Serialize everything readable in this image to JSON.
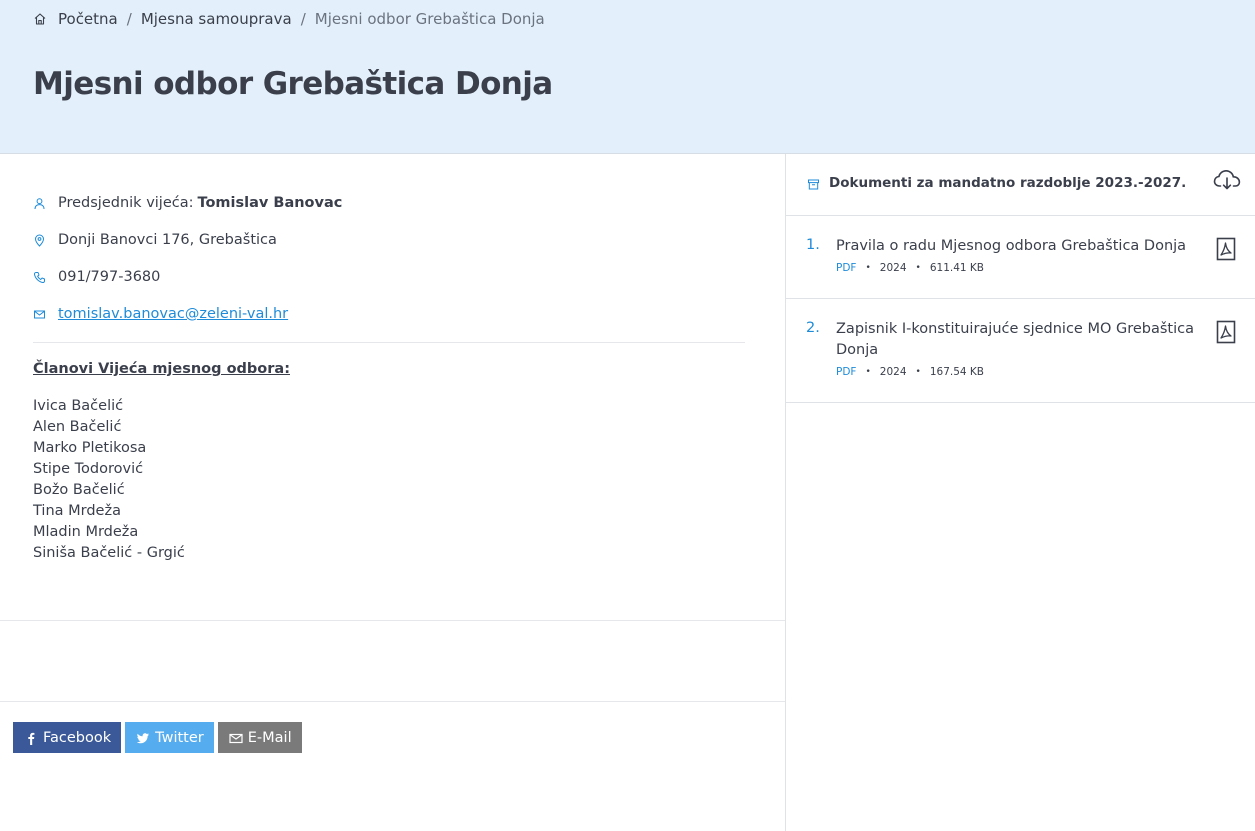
{
  "breadcrumb": {
    "home": "Početna",
    "section": "Mjesna samouprava",
    "current": "Mjesni odbor Grebaštica Donja"
  },
  "page": {
    "title": "Mjesni odbor Grebaštica Donja"
  },
  "info": {
    "president_label": "Predsjednik vijeća:",
    "president_name": "Tomislav Banovac",
    "address": "Donji Banovci 176, Grebaštica",
    "phone": "091/797-3680",
    "email": "tomislav.banovac@zeleni-val.hr"
  },
  "members": {
    "heading": "Članovi Vijeća mjesnog odbora:",
    "list": [
      "Ivica Bačelić",
      "Alen Bačelić",
      "Marko Pletikosa",
      "Stipe Todorović",
      "Božo Bačelić",
      "Tina Mrdeža",
      "Mladin Mrdeža",
      "Siniša Bačelić - Grgić"
    ]
  },
  "share": {
    "facebook": "Facebook",
    "twitter": "Twitter",
    "email": "E-Mail"
  },
  "documents": {
    "title": "Dokumenti za mandatno razdoblje 2023.-2027.",
    "items": [
      {
        "num": "1.",
        "title": "Pravila o radu Mjesnog odbora Grebaštica Donja",
        "type": "PDF",
        "year": "2024",
        "size": "611.41 KB"
      },
      {
        "num": "2.",
        "title": "Zapisnik I-konstituirajuće sjednice MO Grebaštica Donja",
        "type": "PDF",
        "year": "2024",
        "size": "167.54 KB"
      }
    ]
  },
  "colors": {
    "hero_bg": "#e3f0fb",
    "accent": "#1e8bd9",
    "text": "#3a3f4b",
    "facebook": "#3b5998",
    "twitter": "#55acee",
    "email_btn": "#7a7a7a"
  },
  "icons": [
    "home-icon",
    "user-icon",
    "map-pin-icon",
    "phone-icon",
    "mail-icon",
    "archive-icon",
    "cloud-download-icon",
    "pdf-file-icon",
    "facebook-icon",
    "twitter-icon",
    "envelope-icon"
  ]
}
